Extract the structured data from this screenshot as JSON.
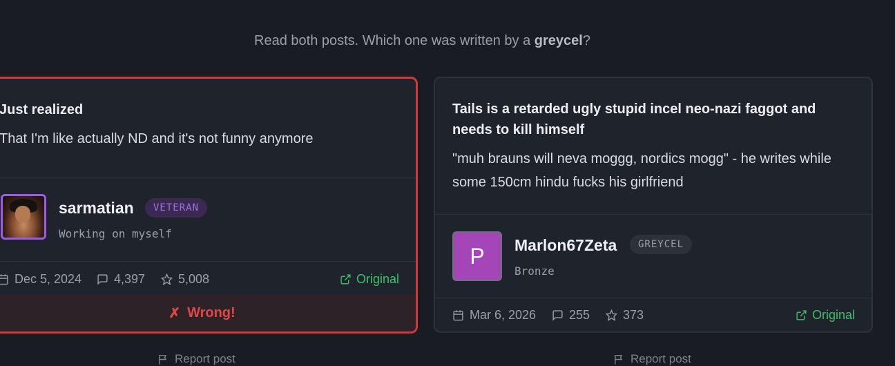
{
  "question": {
    "prefix": "Read both posts. Which one was written by a ",
    "highlight": "greycel",
    "suffix": "?"
  },
  "colors": {
    "wrong_border": "#d23a3a",
    "veteran_badge": "#a070e0",
    "original_link": "#3fbf6b",
    "greycel_avatar": "#a445b8"
  },
  "posts": [
    {
      "title": "Just realized",
      "body": "That I'm like actually ND and it's not funny anymore",
      "username": "sarmatian",
      "badge": "VETERAN",
      "subtitle": "Working on myself",
      "date": "Dec 5, 2024",
      "replies": "4,397",
      "stars": "5,008",
      "original_label": "Original",
      "result_icon": "✗",
      "result_label": "Wrong!",
      "report_label": "Report post"
    },
    {
      "title": "Tails is a retarded ugly stupid incel neo-nazi faggot and needs to kill himself",
      "body": "\"muh brauns will neva moggg, nordics mogg\" - he writes while some 150cm hindu fucks his girlfriend",
      "avatar_letter": "P",
      "username": "Marlon67Zeta",
      "badge": "GREYCEL",
      "subtitle": "Bronze",
      "date": "Mar 6, 2026",
      "replies": "255",
      "stars": "373",
      "original_label": "Original",
      "report_label": "Report post"
    }
  ]
}
